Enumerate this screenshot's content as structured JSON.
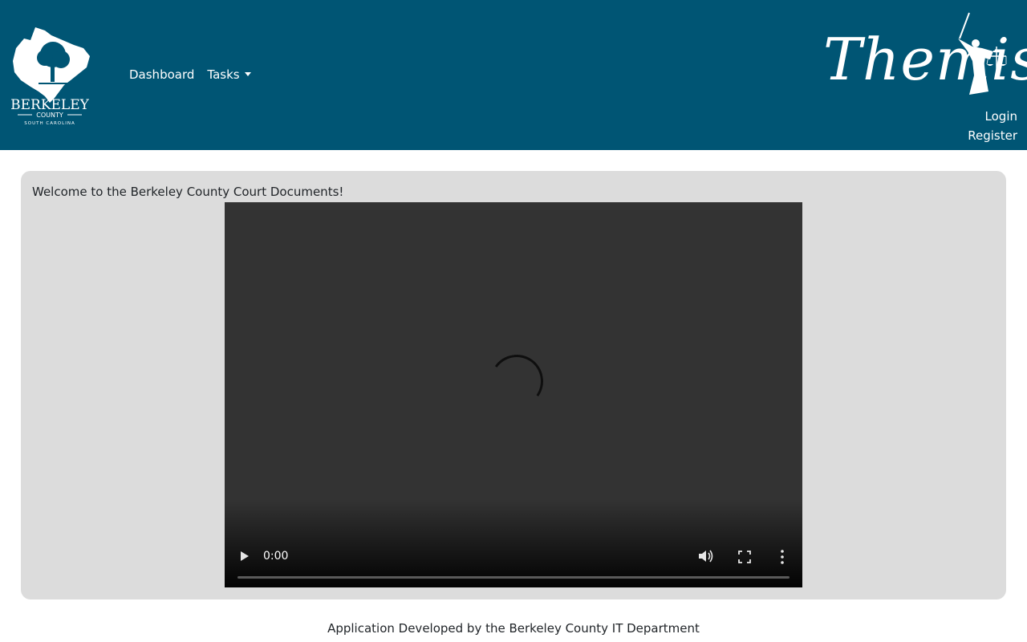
{
  "header": {
    "county_logo_name": "county-seal-icon",
    "county_logo_text": "BERKELEY",
    "county_logo_sub": "COUNTY",
    "county_logo_state": "SOUTH CAROLINA",
    "nav": [
      {
        "label": "Dashboard"
      },
      {
        "label": "Tasks"
      }
    ],
    "brand": "Themis",
    "auth": {
      "login": "Login",
      "register": "Register"
    },
    "colors": {
      "navbar": "#005574",
      "text": "#ffffff"
    }
  },
  "main": {
    "welcome": "Welcome to the Berkeley County Court Documents!",
    "video": {
      "time": "0:00",
      "progress": 0,
      "state": "loading"
    },
    "colors": {
      "card": "#dcdcdc",
      "video": "#333333"
    }
  },
  "footer": {
    "text": "Application Developed by the Berkeley County IT Department"
  }
}
